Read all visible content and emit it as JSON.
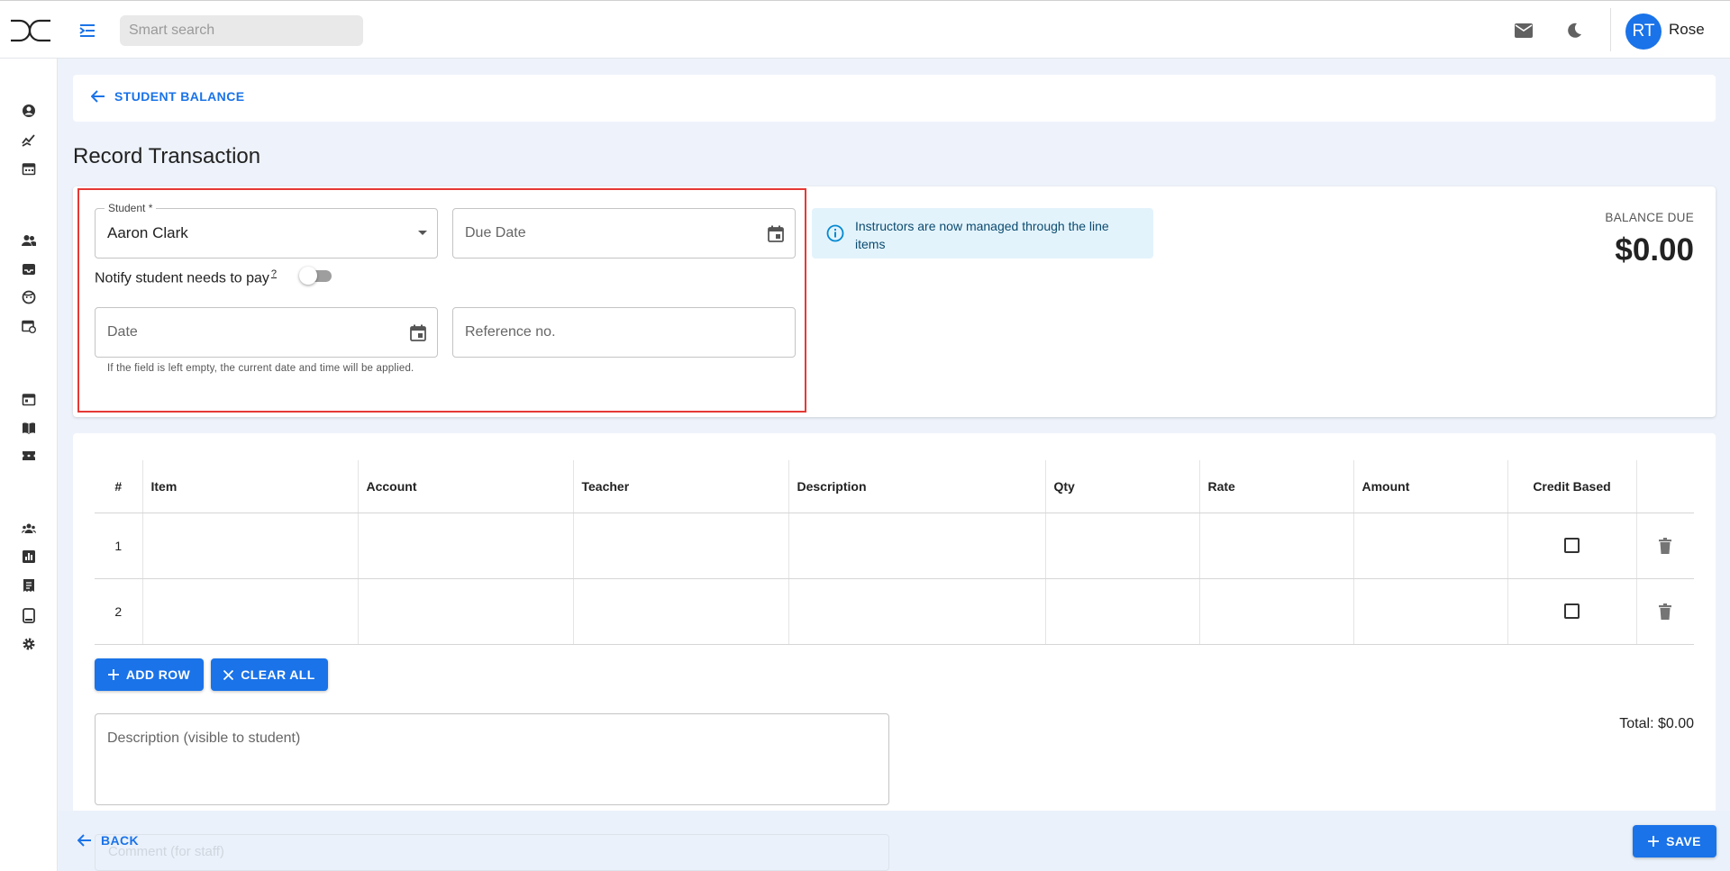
{
  "header": {
    "search_placeholder": "Smart search",
    "avatar_initials": "RT",
    "username": "Rose"
  },
  "sidebar": {
    "icons": [
      "account-circle-icon",
      "trending-icon",
      "calendar-icon",
      "people-icon",
      "inbox-icon",
      "face-icon",
      "event-clock-icon",
      "event-icon",
      "book-icon",
      "ticket-icon",
      "groups-icon",
      "bar-chart-icon",
      "receipt-icon",
      "tablet-icon",
      "gear-icon"
    ]
  },
  "breadcrumb": {
    "label": "STUDENT BALANCE"
  },
  "page": {
    "title": "Record Transaction"
  },
  "form": {
    "student_label": "Student *",
    "student_value": "Aaron Clark",
    "due_date_placeholder": "Due Date",
    "notify_label": "Notify student needs to pay",
    "notify_hint": "?",
    "notify_enabled": false,
    "date_placeholder": "Date",
    "reference_placeholder": "Reference no.",
    "date_helper": "If the field is left empty, the current date and time will be applied."
  },
  "info": {
    "text": "Instructors are now managed through the line items"
  },
  "balance": {
    "label": "BALANCE DUE",
    "value": "$0.00"
  },
  "table": {
    "columns": [
      "#",
      "Item",
      "Account",
      "Teacher",
      "Description",
      "Qty",
      "Rate",
      "Amount",
      "Credit Based"
    ],
    "rows": [
      {
        "num": "1",
        "credit_based": false
      },
      {
        "num": "2",
        "credit_based": false
      }
    ]
  },
  "actions": {
    "add_row": "ADD ROW",
    "clear_all": "CLEAR ALL",
    "back": "BACK",
    "save": "SAVE"
  },
  "description": {
    "placeholder": "Description (visible to student)"
  },
  "comment": {
    "placeholder": "Comment (for staff)"
  },
  "total": {
    "text": "Total: $0.00"
  },
  "colors": {
    "accent": "#1a73e8",
    "highlight": "#e53935",
    "info_bg": "#e3f3fc"
  }
}
